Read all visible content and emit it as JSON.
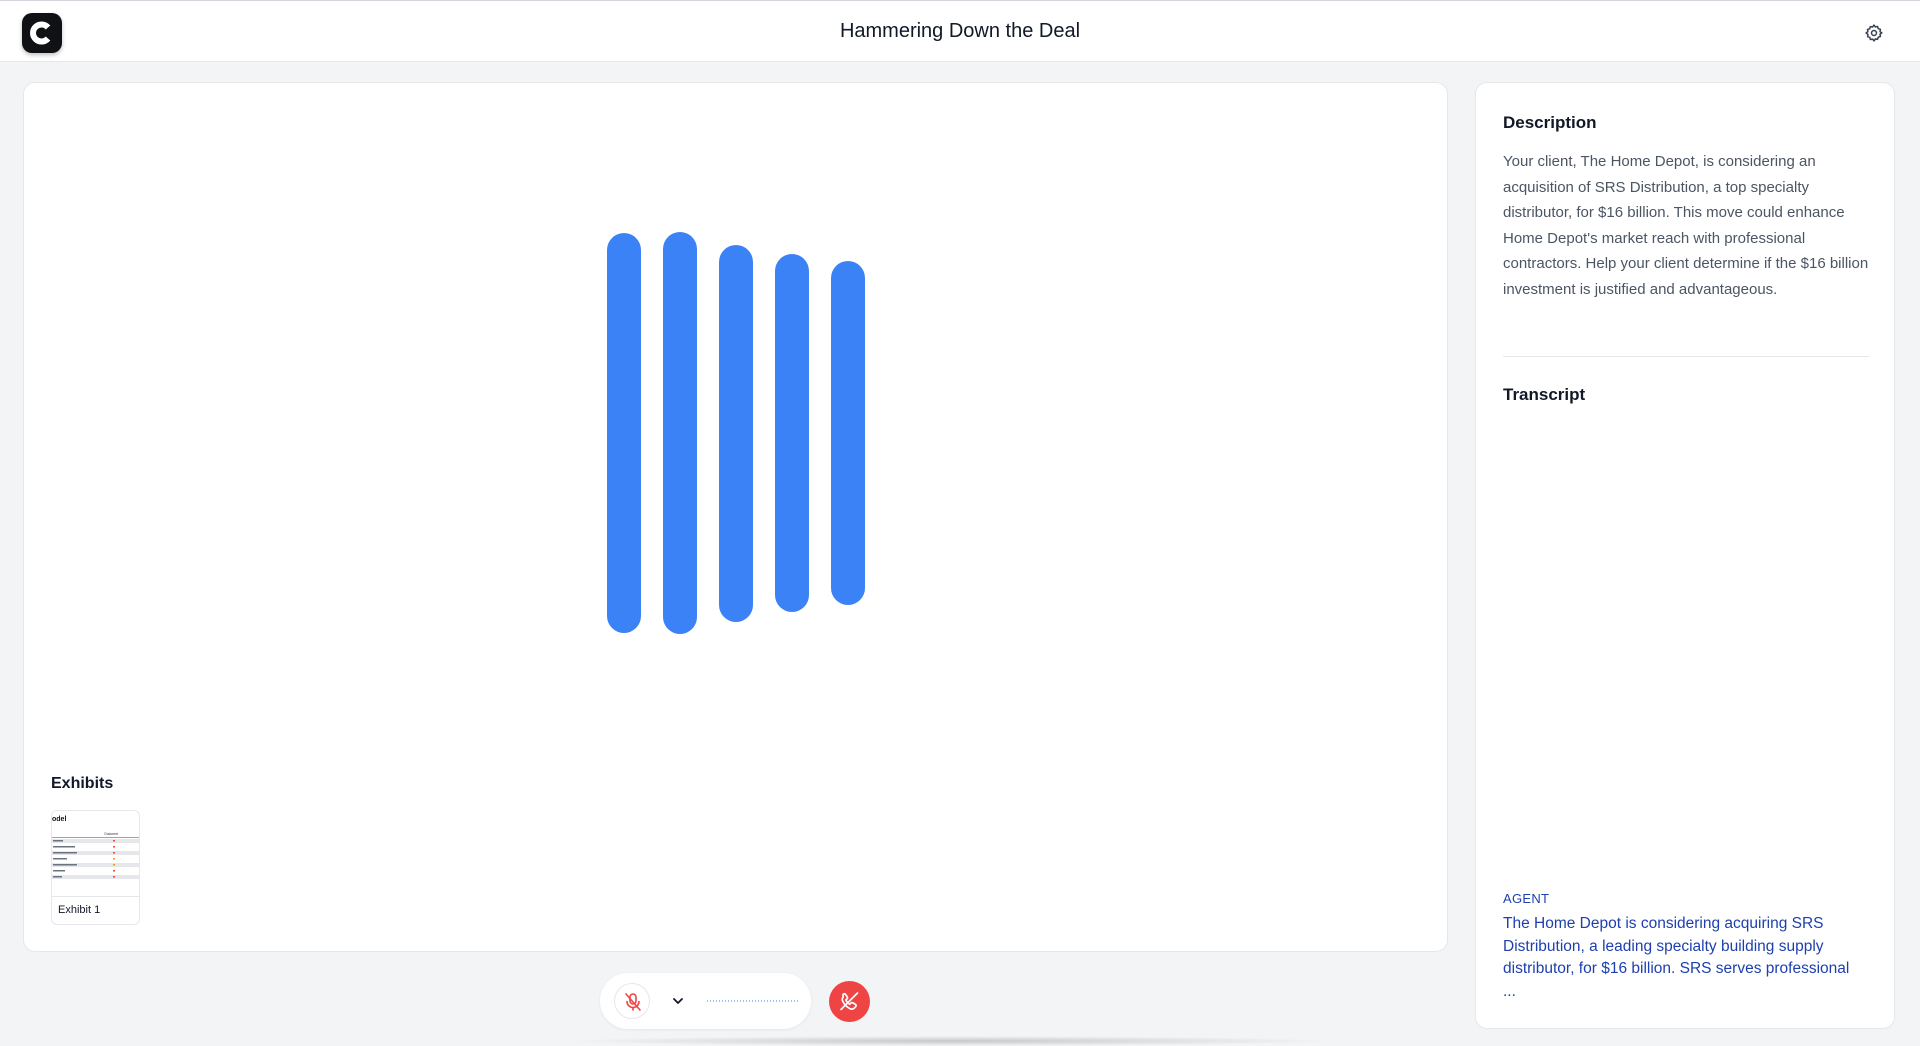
{
  "header": {
    "title": "Hammering Down the Deal",
    "logo_letter": "C"
  },
  "main": {
    "visualizer_color": "#3b82f6",
    "exhibits": {
      "title": "Exhibits",
      "items": [
        {
          "label": "Exhibit 1",
          "thumb_heading": "odel",
          "thumb_column": "Outcome"
        }
      ]
    }
  },
  "sidebar": {
    "description_title": "Description",
    "description_text": "Your client, The Home Depot, is considering an acquisition of SRS Distribution, a top specialty distributor, for $16 billion. This move could enhance Home Depot's market reach with professional contractors. Help your client determine if the $16 billion investment is justified and advantageous.",
    "transcript_title": "Transcript",
    "transcript": [
      {
        "speaker": "AGENT",
        "text": "The Home Depot is considering acquiring SRS Distribution, a leading specialty building supply distributor, for $16 billion. SRS serves professional ..."
      }
    ]
  },
  "controls": {
    "mic_state": "muted",
    "mic_icon": "mic-off-icon",
    "hangup_icon": "phone-off-icon",
    "hangup_color": "#ef4444"
  }
}
